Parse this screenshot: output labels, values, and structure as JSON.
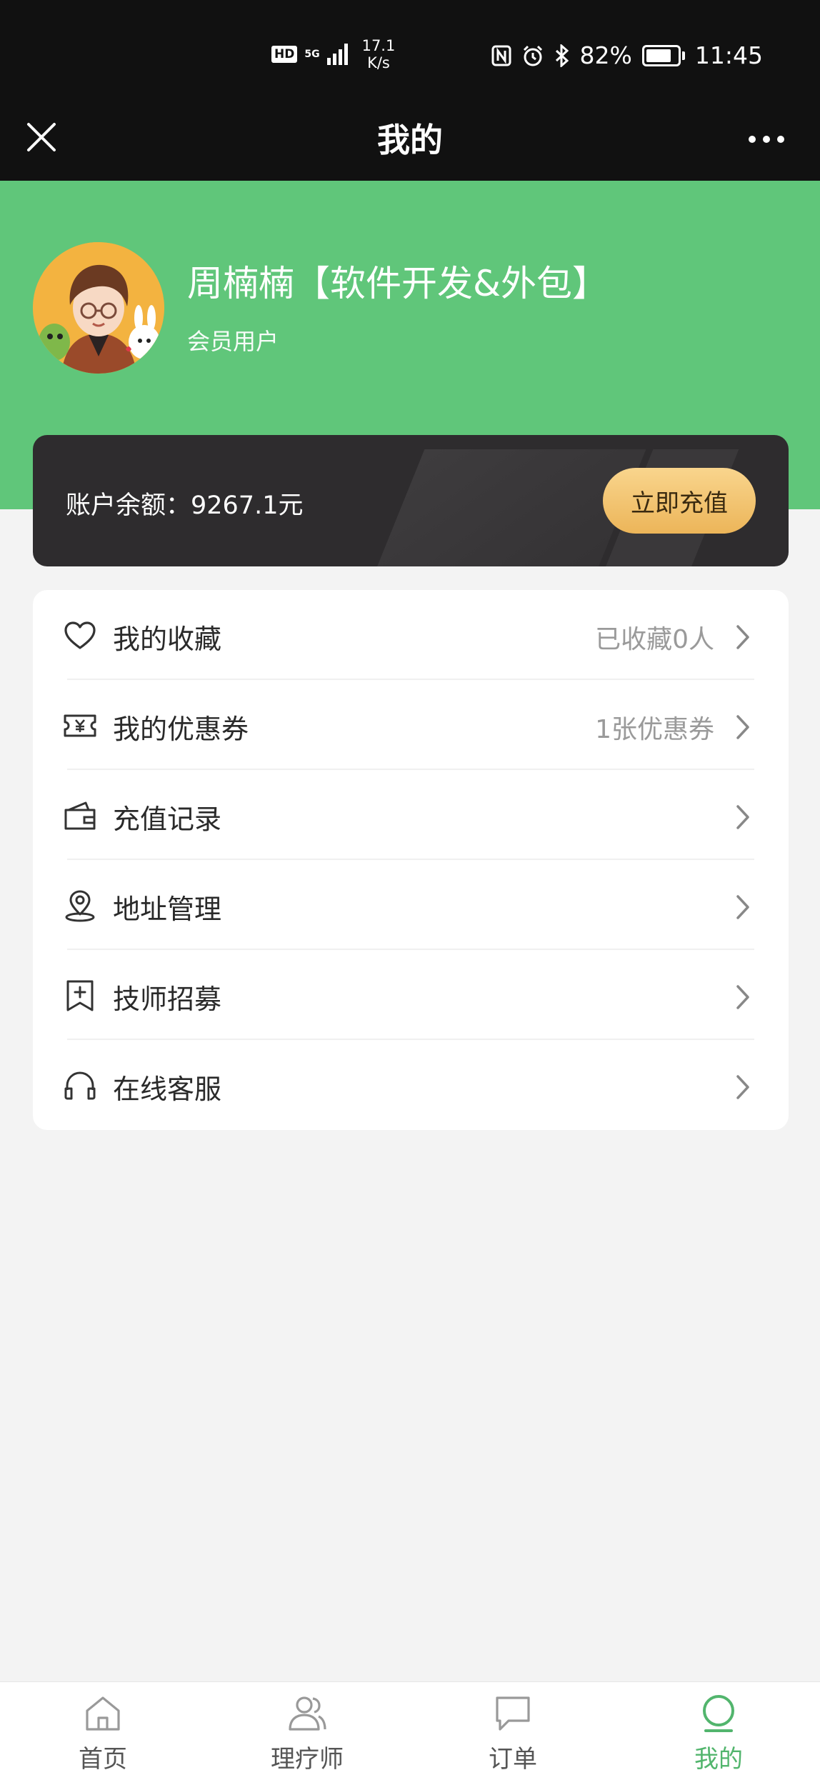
{
  "status_bar": {
    "hd": "HD",
    "network": "5G",
    "speed_value": "17.1",
    "speed_unit": "K/s",
    "battery_percent": "82%",
    "battery_level": 0.82,
    "time": "11:45"
  },
  "nav": {
    "title": "我的"
  },
  "profile": {
    "name": "周楠楠【软件开发&外包】",
    "role": "会员用户"
  },
  "balance": {
    "label": "账户余额：9267.1元",
    "recharge_button": "立即充值"
  },
  "menu": {
    "items": [
      {
        "icon": "heart-icon",
        "label": "我的收藏",
        "value": "已收藏0人"
      },
      {
        "icon": "coupon-icon",
        "label": "我的优惠券",
        "value": "1张优惠券"
      },
      {
        "icon": "wallet-icon",
        "label": "充值记录",
        "value": ""
      },
      {
        "icon": "location-icon",
        "label": "地址管理",
        "value": ""
      },
      {
        "icon": "recruit-bookmark-icon",
        "label": "技师招募",
        "value": ""
      },
      {
        "icon": "headset-icon",
        "label": "在线客服",
        "value": ""
      }
    ]
  },
  "tabbar": {
    "items": [
      {
        "icon": "home-icon",
        "label": "首页"
      },
      {
        "icon": "therapist-icon",
        "label": "理疗师"
      },
      {
        "icon": "order-chat-icon",
        "label": "订单"
      },
      {
        "icon": "profile-icon",
        "label": "我的"
      }
    ],
    "active_index": 3
  },
  "colors": {
    "hero_green": "#60c67a",
    "active_tab": "#52b56d",
    "recharge_gold": "#ecb559",
    "card_dark": "#2e2c2e"
  }
}
